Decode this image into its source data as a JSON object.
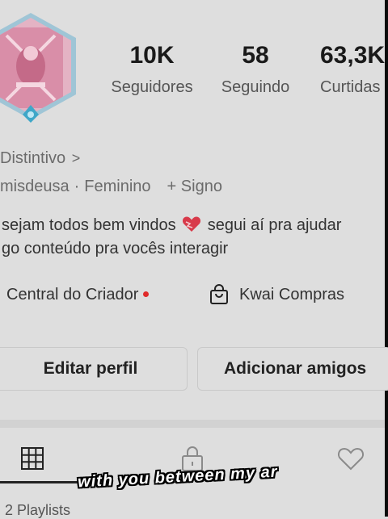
{
  "profile": {
    "stats": {
      "followers": {
        "value": "10K",
        "label": "Seguidores"
      },
      "following": {
        "value": "58",
        "label": "Seguindo"
      },
      "likes": {
        "value": "63,3K",
        "label": "Curtidas"
      }
    },
    "badge_label": "Distintivo",
    "badge_chevron": ">",
    "username_fragment": "misdeusa",
    "separator": "·",
    "gender": "Feminino",
    "sign": "+ Signo",
    "bio_line1_a": "sejam todos bem vindos",
    "bio_line1_b": "segui aí pra ajudar",
    "bio_line2": "go conteúdo pra vocês interagir"
  },
  "links": {
    "creator_center": "Central do Criador",
    "shop": "Kwai Compras"
  },
  "buttons": {
    "edit_profile": "Editar perfil",
    "add_friends": "Adicionar amigos"
  },
  "tabs": {
    "items": [
      {
        "icon": "grid-icon"
      },
      {
        "icon": "lock-icon"
      },
      {
        "icon": "heart-outline-icon"
      }
    ]
  },
  "content": {
    "playlists": "2 Playlists"
  },
  "overlay": {
    "caption": "with you between my ar"
  },
  "colors": {
    "background": "#dedede",
    "notification_dot": "#e02b2b",
    "heart_emoji": "#d83a4a"
  }
}
